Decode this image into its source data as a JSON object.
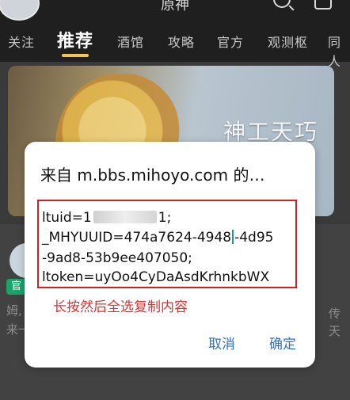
{
  "app": {
    "title": "原神",
    "tabs": [
      "关注",
      "推荐",
      "酒馆",
      "攻略",
      "官方",
      "观测枢",
      "同人"
    ],
    "active_tab_index": 1
  },
  "banner": {
    "text": "神工天巧"
  },
  "feed": {
    "official_tag": "官",
    "snippet_line_1": "姆,",
    "snippet_line_2": "来一",
    "right_line_1": "传",
    "right_line_2": "天"
  },
  "dialog": {
    "title": "来自 m.bbs.mihoyo.com 的…",
    "lines": {
      "l1_prefix": "ltuid=1",
      "l1_suffix": "1;",
      "l2_prefix": "_MHYUUID=474a7624-4948",
      "l2_suffix": "-4d95",
      "l3": "-9ad8-53b9ee407050;",
      "l4": "ltoken=uyOo4CyDaAsdKrhnkbWX"
    },
    "hint": "长按然后全选复制内容",
    "buttons": {
      "cancel": "取消",
      "ok": "确定"
    }
  }
}
